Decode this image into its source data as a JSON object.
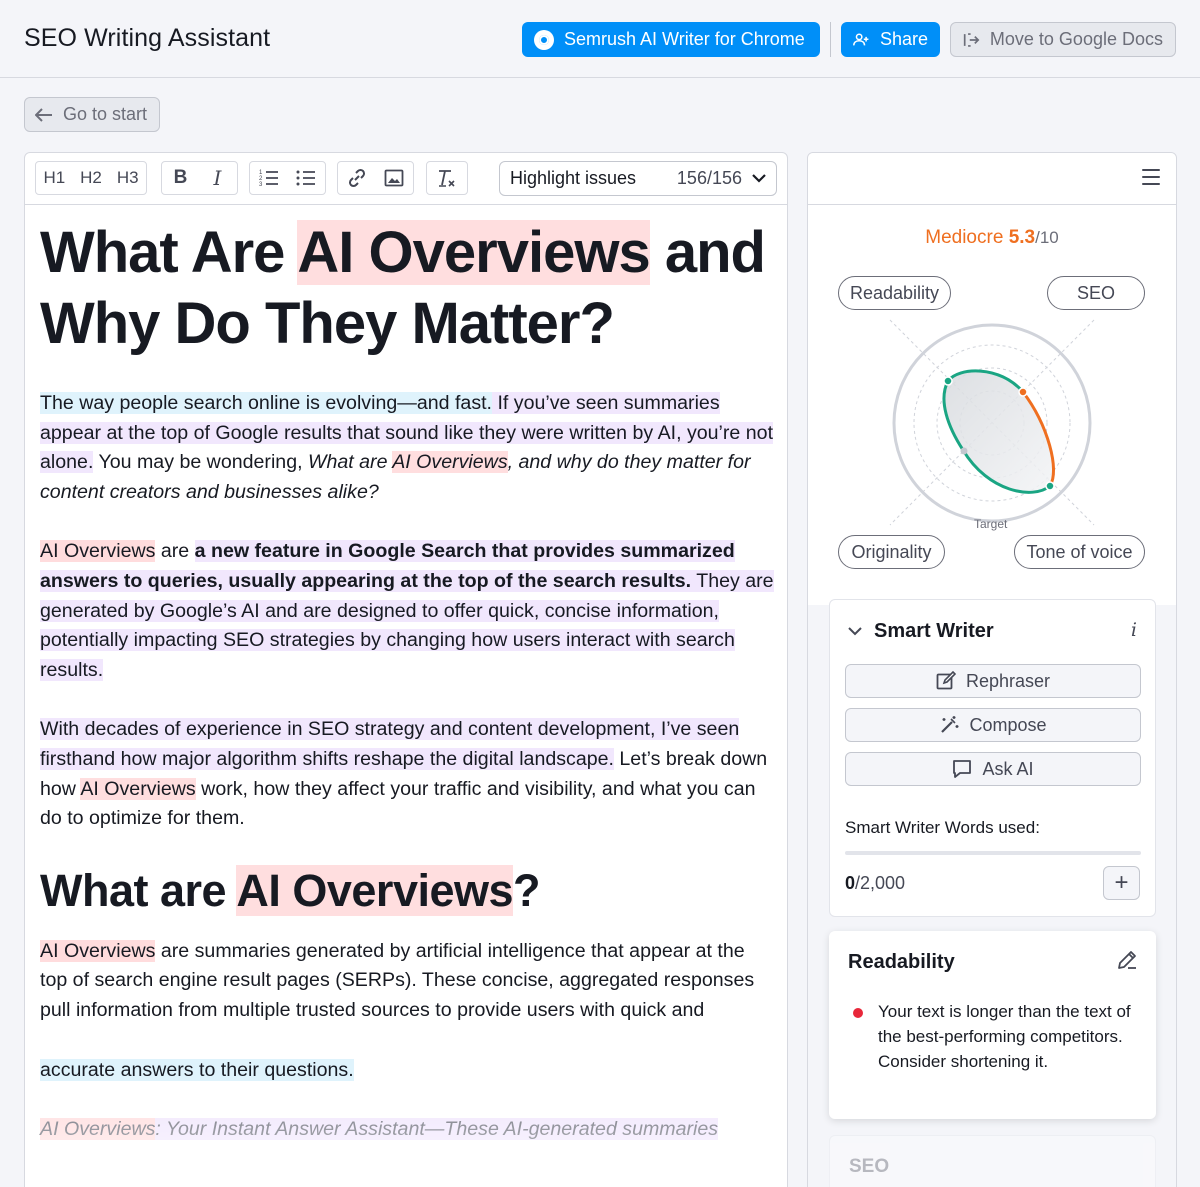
{
  "header": {
    "title": "SEO Writing Assistant",
    "chrome_button": "Semrush AI Writer for Chrome",
    "share_button": "Share",
    "move_button": "Move to Google Docs"
  },
  "nav": {
    "go_to_start": "Go to start"
  },
  "toolbar": {
    "h1": "H1",
    "h2": "H2",
    "h3": "H3",
    "bold": "B",
    "italic": "I",
    "highlight_label": "Highlight issues",
    "highlight_count": "156/156"
  },
  "article": {
    "title_part1": "What Are ",
    "title_highlight": "AI Overviews",
    "title_part2": " and Why Do They Matter?",
    "p1_s1": "The way people search online is evolving—and fast.",
    "p1_s2": " If you’ve seen summaries appear at the top of Google results that sound like they were written by AI, you’re not alone.",
    "p1_s3": " You may be wondering, ",
    "p1_s4": "What are ",
    "p1_s5": "AI Overviews",
    "p1_s6": ", and why do they matter for content creators and businesses alike?",
    "p2_s1": "AI Overviews",
    "p2_s2": " are ",
    "p2_s3": "a new feature in Google Search that provides summarized answers to queries, usually appearing at the top of the search results.",
    "p2_s4": " They are generated by Google’s AI and are designed to offer quick, concise information, potentially impacting SEO strategies by changing how users interact with search results.",
    "p3_s1": "With decades of experience in SEO strategy and content development, I’ve seen firsthand how major algorithm shifts reshape the digital landscape.",
    "p3_s2": " Let’s break down how ",
    "p3_s3": "AI Overviews",
    "p3_s4": " work, how they affect your traffic and visibility, and what you can do to optimize for them.",
    "h2_part1": "What are ",
    "h2_highlight": "AI Overviews",
    "h2_part2": "?",
    "p4_s1": "AI Overviews",
    "p4_s2": " are summaries generated by artificial intelligence that appear at the top of search engine result pages (SERPs). These concise, aggregated responses pull information from multiple trusted sources to provide users with quick and",
    "p5": "accurate answers to their questions.",
    "p6_s1": "AI Overviews",
    "p6_s2": ": Your Instant Answer Assistant—These AI-generated summaries"
  },
  "panel": {
    "score_label": "Mediocre",
    "score_value": "5.3",
    "score_max": "/10",
    "axes": {
      "readability": "Readability",
      "seo": "SEO",
      "originality": "Originality",
      "tone": "Tone of voice",
      "target": "Target"
    },
    "smart_writer": {
      "title": "Smart Writer",
      "info": "i",
      "rephraser": "Rephraser",
      "compose": "Compose",
      "ask_ai": "Ask AI",
      "words_label": "Smart Writer Words used:",
      "words_used": "0",
      "words_total": "/2,000",
      "words_fraction": 0,
      "plus": "+"
    },
    "readability": {
      "title": "Readability",
      "issue": "Your text is longer than the text of the best-performing competitors. Consider shortening it."
    },
    "seo": {
      "title": "SEO"
    }
  },
  "colors": {
    "primary": "#008ff8",
    "score_orange": "#ef6f20",
    "highlight_blue": "#dff3fc",
    "highlight_purple": "#f1e7fd",
    "highlight_red": "#ffdedf",
    "chart_green": "#1aa583",
    "issue_red": "#e8273a"
  }
}
